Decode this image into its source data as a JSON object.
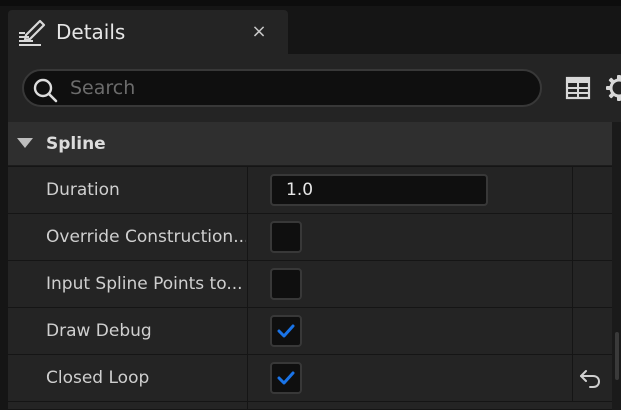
{
  "tab": {
    "title": "Details",
    "close_glyph": "×",
    "icon": "edit-details-icon"
  },
  "search": {
    "placeholder": "Search",
    "value": ""
  },
  "toolbar": {
    "table_icon": "table-grid-icon",
    "settings_icon": "gear-icon"
  },
  "category": {
    "title": "Spline",
    "expanded": true
  },
  "rows": [
    {
      "label": "Duration",
      "type": "number",
      "value": "1.0"
    },
    {
      "label": "Override Construction...",
      "type": "checkbox",
      "checked": false
    },
    {
      "label": "Input Spline Points to...",
      "type": "checkbox",
      "checked": false
    },
    {
      "label": "Draw Debug",
      "type": "checkbox",
      "checked": true
    },
    {
      "label": "Closed Loop",
      "type": "checkbox",
      "checked": true,
      "reset_to_default": true
    }
  ],
  "colors": {
    "accent_check": "#1a74e8",
    "panel_bg": "#242424",
    "category_bg": "#2f2f2f",
    "field_bg": "#0f0f0f"
  }
}
